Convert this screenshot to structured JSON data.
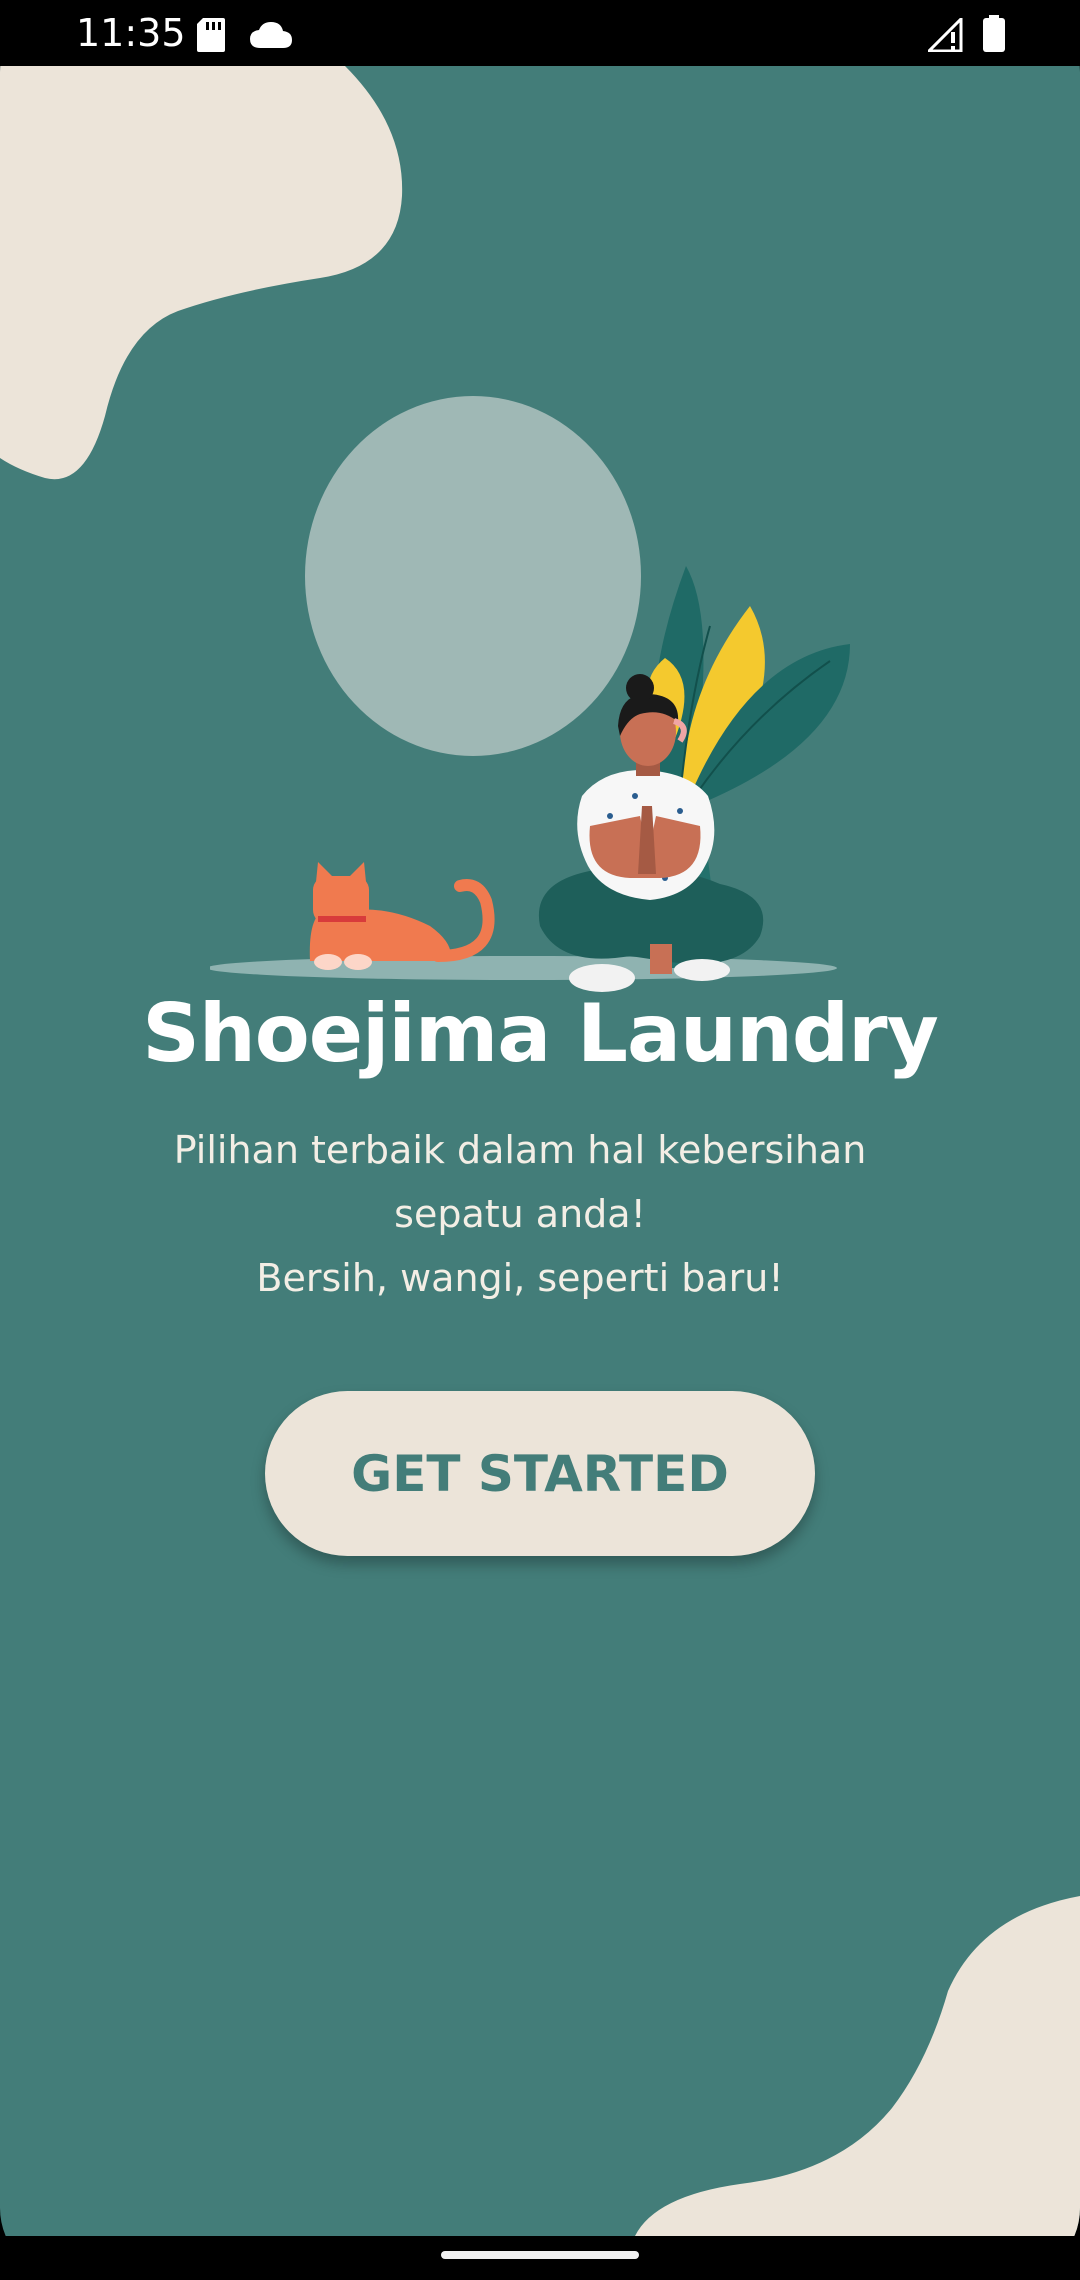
{
  "status_bar": {
    "time": "11:35",
    "left_icons": [
      "sd-card-icon",
      "cloud-icon"
    ],
    "right_icons": [
      "signal-no-service-icon",
      "battery-icon"
    ]
  },
  "app": {
    "title": "Shoejima Laundry",
    "subtitle_lines": [
      "Pilihan terbaik dalam hal kebersihan",
      "sepatu anda!",
      "Bersih, wangi, seperti baru!"
    ],
    "cta_label": "GET STARTED"
  },
  "illustration": {
    "subject": "person meditating with cat and plant",
    "icons": [
      "cat-icon",
      "plant-icon",
      "person-icon"
    ]
  },
  "colors": {
    "background": "#437d79",
    "blob": "#ece4d9",
    "button_bg": "#ece4d9",
    "button_text": "#437d79",
    "title_text": "#ffffff"
  },
  "nav_bar": {
    "handle": "gesture-handle"
  }
}
